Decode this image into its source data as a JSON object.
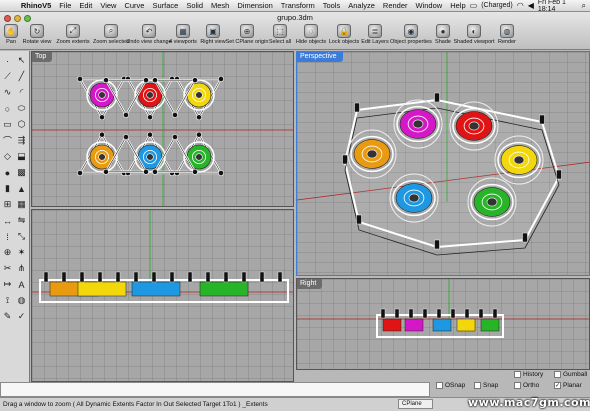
{
  "menubar": {
    "apple": "",
    "app_name": "RhinoV5",
    "items": [
      "File",
      "Edit",
      "View",
      "Curve",
      "Surface",
      "Solid",
      "Mesh",
      "Dimension",
      "Transform",
      "Tools",
      "Analyze",
      "Render",
      "Window",
      "Help"
    ],
    "battery": "(Charged)",
    "clock": "Fri Feb 1  18:14"
  },
  "window": {
    "title": "grupo.3dm"
  },
  "toolbar": {
    "tools": [
      {
        "label": "Pan",
        "icon": "hand-icon",
        "glyph": "✋"
      },
      {
        "label": "Rotate view",
        "icon": "rotate-icon",
        "glyph": "↻"
      },
      {
        "label": "Zoom extents",
        "icon": "zoom-extents-icon",
        "glyph": "⤢"
      },
      {
        "label": "Zoom selected",
        "icon": "zoom-selected-icon",
        "glyph": "⌕"
      },
      {
        "label": "Undo view change",
        "icon": "undo-view-icon",
        "glyph": "↶"
      },
      {
        "label": "4 viewports",
        "icon": "four-viewports-icon",
        "glyph": "▦"
      },
      {
        "label": "Right view",
        "icon": "right-view-icon",
        "glyph": "▣"
      },
      {
        "label": "Set CPlane origin",
        "icon": "cplane-origin-icon",
        "glyph": "⊕"
      },
      {
        "label": "Select all",
        "icon": "select-all-icon",
        "glyph": "⬚"
      },
      {
        "label": "Hide objects",
        "icon": "hide-objects-icon",
        "glyph": "◌"
      },
      {
        "label": "Lock objects",
        "icon": "lock-icon",
        "glyph": "🔒"
      },
      {
        "label": "Edit Layers",
        "icon": "layers-icon",
        "glyph": "≣"
      },
      {
        "label": "Object properties",
        "icon": "properties-icon",
        "glyph": "◉"
      },
      {
        "label": "Shade",
        "icon": "shade-icon",
        "glyph": "●"
      },
      {
        "label": "Shaded viewport",
        "icon": "shaded-viewport-icon",
        "glyph": "◐"
      },
      {
        "label": "Render",
        "icon": "render-icon",
        "glyph": "◍"
      }
    ]
  },
  "palette": {
    "icons": [
      "point-icon",
      "select-icon",
      "polyline-icon",
      "line-icon",
      "curve-icon",
      "arc-icon",
      "circle-icon",
      "ellipse-icon",
      "rectangle-icon",
      "polygon-icon",
      "fillet-icon",
      "offset-icon",
      "surface-icon",
      "extrude-icon",
      "sphere-icon",
      "box-icon",
      "cylinder-icon",
      "cone-icon",
      "boolean-icon",
      "mesh-icon",
      "transform-icon",
      "mirror-icon",
      "array-icon",
      "scale-icon",
      "join-icon",
      "explode-icon",
      "trim-icon",
      "split-icon",
      "dimension-icon",
      "text-icon",
      "analyze-icon",
      "render-tool-icon",
      "paint-icon",
      "check-icon"
    ],
    "glyphs": [
      "·",
      "↖",
      "⟋",
      "╱",
      "∿",
      "◜",
      "○",
      "⬭",
      "▭",
      "⬡",
      "⌒",
      "⇶",
      "◇",
      "⬓",
      "●",
      "▩",
      "▮",
      "▲",
      "⊞",
      "▦",
      "↔",
      "⇋",
      "⁞",
      "⤡",
      "⊕",
      "✶",
      "✂",
      "⋔",
      "↦",
      "A",
      "⟟",
      "◍",
      "✎",
      "✓"
    ]
  },
  "viewports": {
    "top": {
      "label": "Top"
    },
    "perspective": {
      "label": "Perspective"
    },
    "front": {
      "label": ""
    },
    "right": {
      "label": "Right"
    }
  },
  "colors": {
    "magenta": "#d418c8",
    "red": "#e01414",
    "yellow": "#f2d80a",
    "orange": "#e89a10",
    "blue": "#1e98e0",
    "green": "#28b428",
    "active_border": "#3d7bd9"
  },
  "options": {
    "osnap": "OSnap",
    "snap": "Snap",
    "ortho": "Ortho",
    "planar": "Planar",
    "history": "History",
    "gumball": "Gumball"
  },
  "command_line": {
    "value": "",
    "status": "Drag a window to zoom ( All Dynamic Extents Factor In Out Selected Target 1To1 ) _Extents",
    "cplane": "CPlane"
  },
  "watermark": "www.mac7gm.com"
}
